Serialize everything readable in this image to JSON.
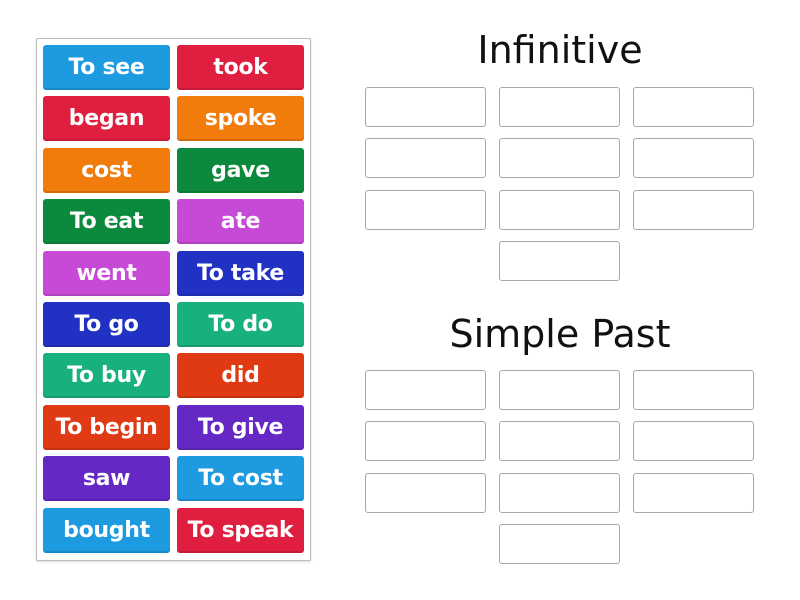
{
  "colors": {
    "blue_light": "#1e9be0",
    "red": "#e01e3f",
    "orange": "#f17c0c",
    "green_dark": "#0b8a3d",
    "magenta": "#c74ad6",
    "blue_dark": "#2131c4",
    "teal": "#18b07f",
    "red_orange": "#e03a14",
    "purple": "#6528c4"
  },
  "tiles": [
    {
      "label": "To see",
      "color": "#1e9be0"
    },
    {
      "label": "took",
      "color": "#e01e3f"
    },
    {
      "label": "began",
      "color": "#e01e3f"
    },
    {
      "label": "spoke",
      "color": "#f17c0c"
    },
    {
      "label": "cost",
      "color": "#f17c0c"
    },
    {
      "label": "gave",
      "color": "#0b8a3d"
    },
    {
      "label": "To eat",
      "color": "#0b8a3d"
    },
    {
      "label": "ate",
      "color": "#c74ad6"
    },
    {
      "label": "went",
      "color": "#c74ad6"
    },
    {
      "label": "To take",
      "color": "#2131c4"
    },
    {
      "label": "To go",
      "color": "#2131c4"
    },
    {
      "label": "To do",
      "color": "#18b07f"
    },
    {
      "label": "To buy",
      "color": "#18b07f"
    },
    {
      "label": "did",
      "color": "#e03a14"
    },
    {
      "label": "To begin",
      "color": "#e03a14"
    },
    {
      "label": "To give",
      "color": "#6528c4"
    },
    {
      "label": "saw",
      "color": "#6528c4"
    },
    {
      "label": "To cost",
      "color": "#1e9be0"
    },
    {
      "label": "bought",
      "color": "#1e9be0"
    },
    {
      "label": "To speak",
      "color": "#e01e3f"
    }
  ],
  "groups": [
    {
      "title": "Infinitive",
      "slots": 10
    },
    {
      "title": "Simple Past",
      "slots": 10
    }
  ]
}
